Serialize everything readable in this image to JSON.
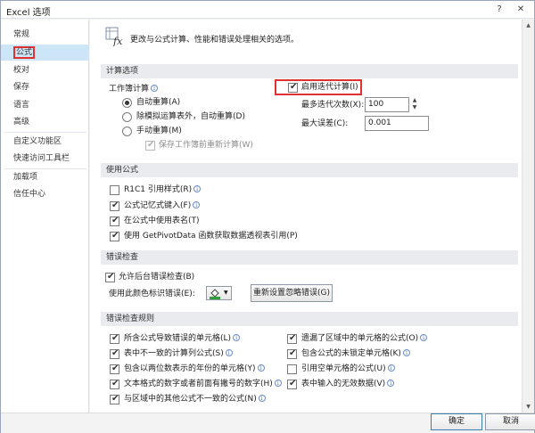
{
  "window": {
    "title": "Excel 选项",
    "help_label": "?",
    "close_label": "✕"
  },
  "sidebar": {
    "items": [
      {
        "label": "常规"
      },
      {
        "label": "公式"
      },
      {
        "label": "校对"
      },
      {
        "label": "保存"
      },
      {
        "label": "语言"
      },
      {
        "label": "高级"
      },
      {
        "label": "自定义功能区"
      },
      {
        "label": "快速访问工具栏"
      },
      {
        "label": "加载项"
      },
      {
        "label": "信任中心"
      }
    ],
    "selected": "公式"
  },
  "header": {
    "text": "更改与公式计算、性能和错误处理相关的选项。",
    "icon_glyph": "fx"
  },
  "calc": {
    "section_title": "计算选项",
    "workbook_label": "工作簿计算",
    "info_glyph": "i",
    "auto": "自动重算(A)",
    "auto_except": "除模拟运算表外，自动重算(D)",
    "manual": "手动重算(M)",
    "recalc_before_save": "保存工作簿前重新计算(W)",
    "iterative": "启用迭代计算(I)",
    "max_iterations_label": "最多迭代次数(X):",
    "max_iterations_value": "100",
    "max_change_label": "最大误差(C):",
    "max_change_value": "0.001"
  },
  "formulas": {
    "section_title": "使用公式",
    "r1c1": "R1C1 引用样式(R)",
    "autocomplete": "公式记忆式键入(F)",
    "table_names": "在公式中使用表名(T)",
    "getpivot": "使用 GetPivotData 函数获取数据透视表引用(P)"
  },
  "error_checking": {
    "section_title": "错误检查",
    "enable_bg": "允许后台错误检查(B)",
    "color_label": "使用此颜色标识错误(E):",
    "reset_button": "重新设置忽略错误(G)",
    "dropdown_arrow": "▼"
  },
  "rules": {
    "section_title": "错误检查规则",
    "left": [
      "所含公式导致错误的单元格(L)",
      "表中不一致的计算列公式(S)",
      "包含以两位数表示的年份的单元格(Y)",
      "文本格式的数字或者前面有撇号的数字(H)",
      "与区域中的其他公式不一致的公式(N)"
    ],
    "right": [
      "遗漏了区域中的单元格的公式(O)",
      "包含公式的未锁定单元格(K)",
      "引用空单元格的公式(U)",
      "表中输入的无效数据(V)"
    ]
  },
  "footer": {
    "ok": "确定",
    "cancel": "取消"
  },
  "scrollbar": {
    "up_arrow": "▲",
    "down_arrow": "▼"
  },
  "colors": {
    "highlight": "#e03030",
    "selected_bg": "#cde6f7",
    "section_bg": "#e9ebee"
  }
}
